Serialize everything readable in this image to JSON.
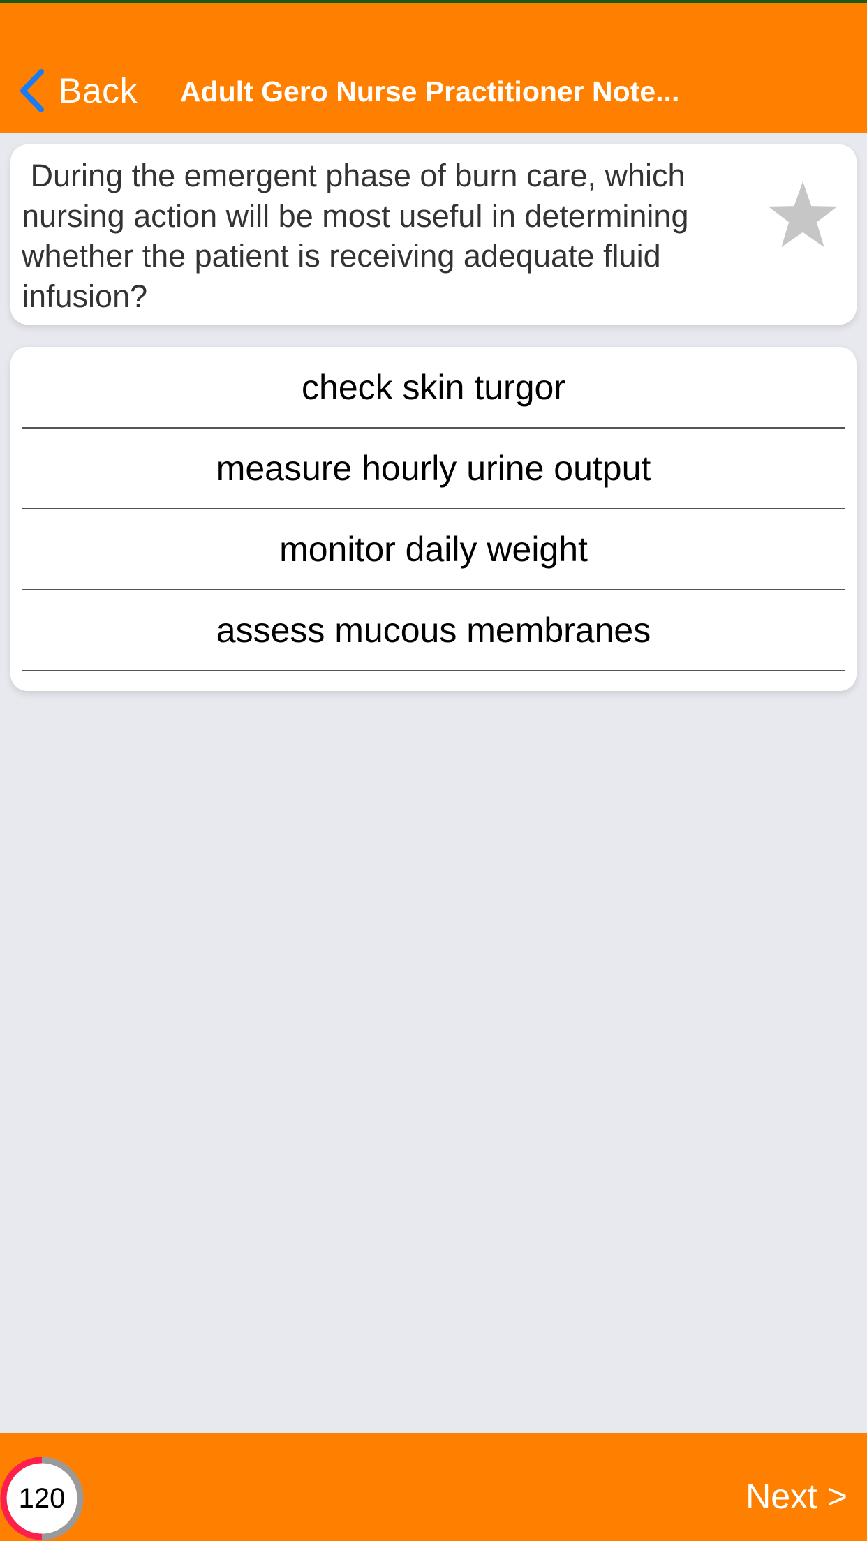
{
  "navbar": {
    "back_label": "Back",
    "title": "Adult Gero Nurse Practitioner Note..."
  },
  "question": {
    "text": " During the emergent phase of burn care, which nursing action will be most useful in determining whether the patient is receiving adequate fluid infusion?",
    "favorite_icon": "star-icon"
  },
  "answers": [
    {
      "label": "check skin turgor"
    },
    {
      "label": "measure hourly urine output"
    },
    {
      "label": "monitor daily weight"
    },
    {
      "label": "assess mucous membranes"
    }
  ],
  "footer": {
    "timer_value": "120",
    "next_label": "Next >"
  },
  "colors": {
    "accent": "#ff8000",
    "back_chevron": "#1a7cf5",
    "timer_ring": "#ff1f4b",
    "star": "#c6c6c6"
  }
}
